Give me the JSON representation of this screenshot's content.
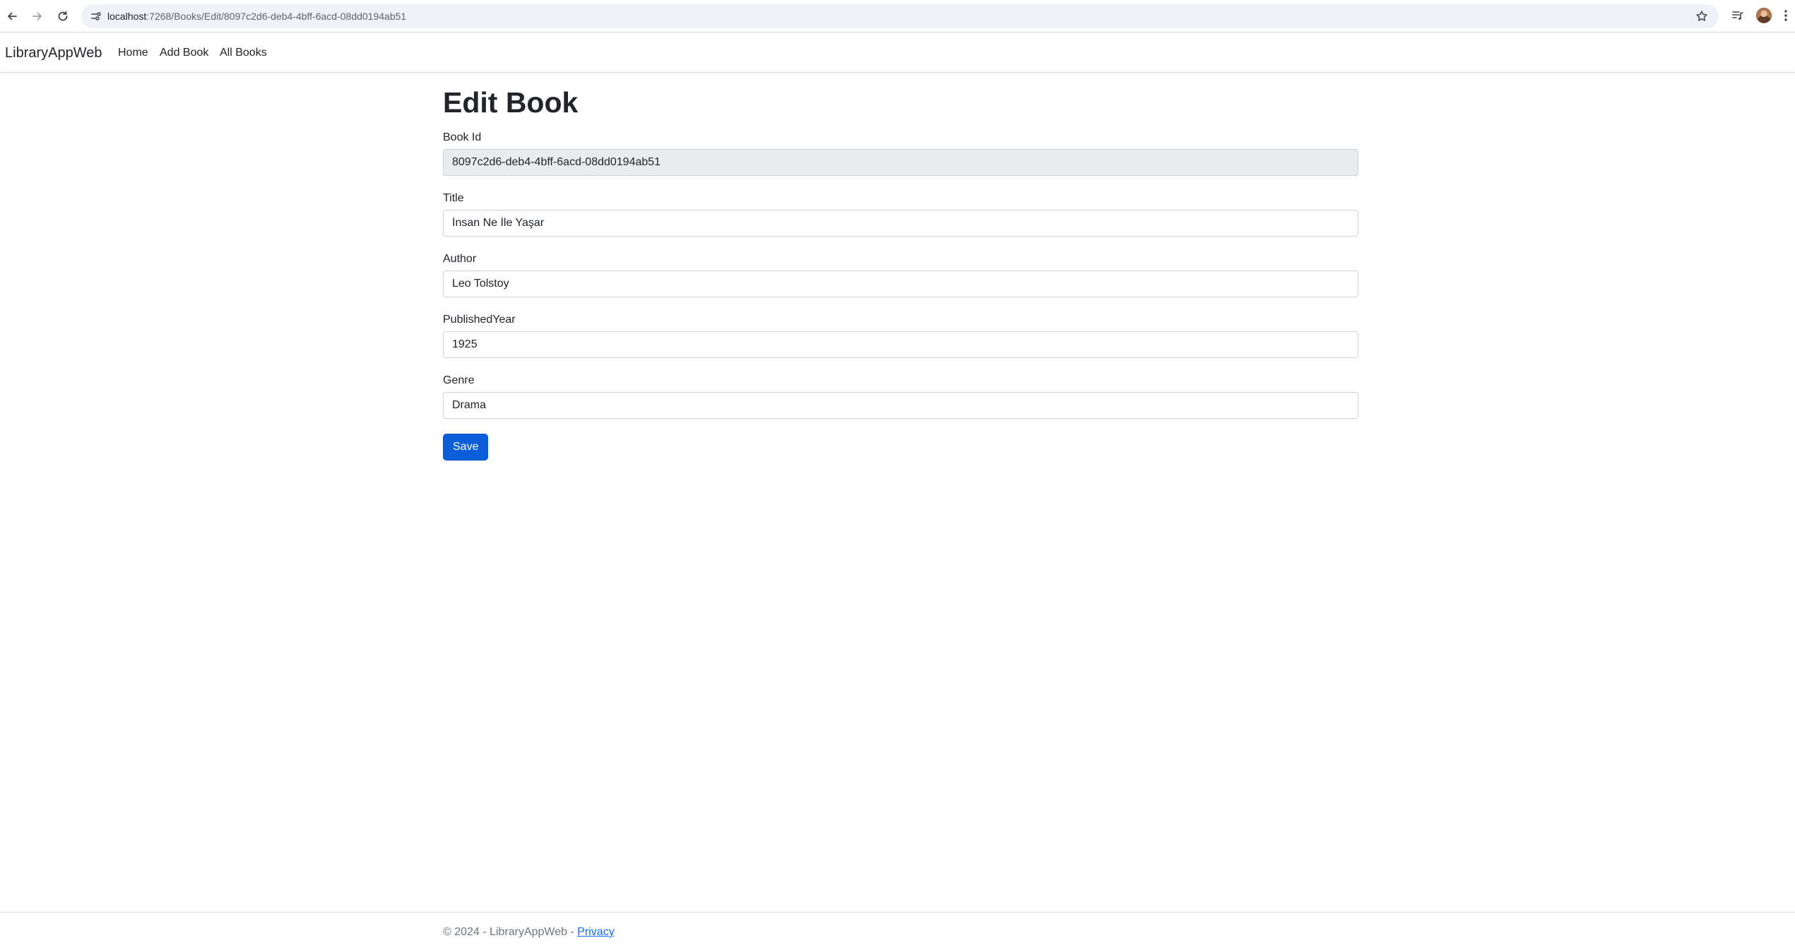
{
  "browser": {
    "url_host": "localhost",
    "url_path": ":7268/Books/Edit/8097c2d6-deb4-4bff-6acd-08dd0194ab51",
    "icons": [
      "back-arrow-icon",
      "forward-arrow-icon",
      "reload-icon",
      "site-info-icon",
      "bookmark-star-icon",
      "media-control-icon",
      "profile-avatar",
      "more-vert-icon"
    ]
  },
  "navbar": {
    "brand": "LibraryAppWeb",
    "links": [
      {
        "label": "Home"
      },
      {
        "label": "Add Book"
      },
      {
        "label": "All Books"
      }
    ]
  },
  "page": {
    "title": "Edit Book"
  },
  "form": {
    "fields": [
      {
        "label": "Book Id",
        "value": "8097c2d6-deb4-4bff-6acd-08dd0194ab51",
        "readonly": true
      },
      {
        "label": "Title",
        "value": "İnsan Ne İle Yaşar"
      },
      {
        "label": "Author",
        "value": "Leo Tolstoy"
      },
      {
        "label": "PublishedYear",
        "value": "1925"
      },
      {
        "label": "Genre",
        "value": "Drama"
      }
    ],
    "save_label": "Save"
  },
  "footer": {
    "copyright": "© 2024 - LibraryAppWeb - ",
    "privacy_label": "Privacy"
  },
  "colors": {
    "primary_button": "#0b5ed7",
    "readonly_bg": "#e9ecef",
    "link": "#0d6efd"
  }
}
